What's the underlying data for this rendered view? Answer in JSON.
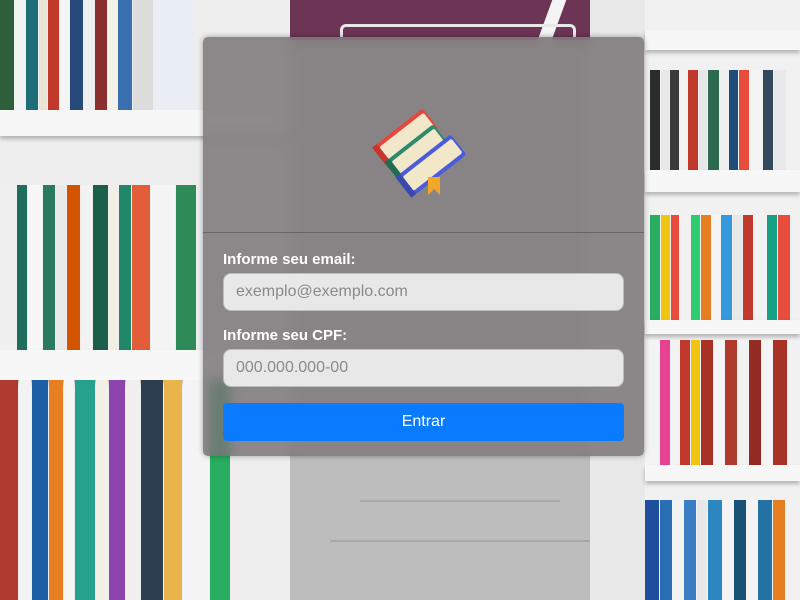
{
  "login": {
    "email_label": "Informe seu email:",
    "email_placeholder": "exemplo@exemplo.com",
    "email_value": "",
    "cpf_label": "Informe seu CPF:",
    "cpf_placeholder": "000.000.000-00",
    "cpf_value": "",
    "submit_label": "Entrar"
  },
  "logo": {
    "icon": "books-icon"
  },
  "colors": {
    "button": "#0a7bff",
    "card_background": "#767073",
    "input_background": "#e8e8e8"
  }
}
